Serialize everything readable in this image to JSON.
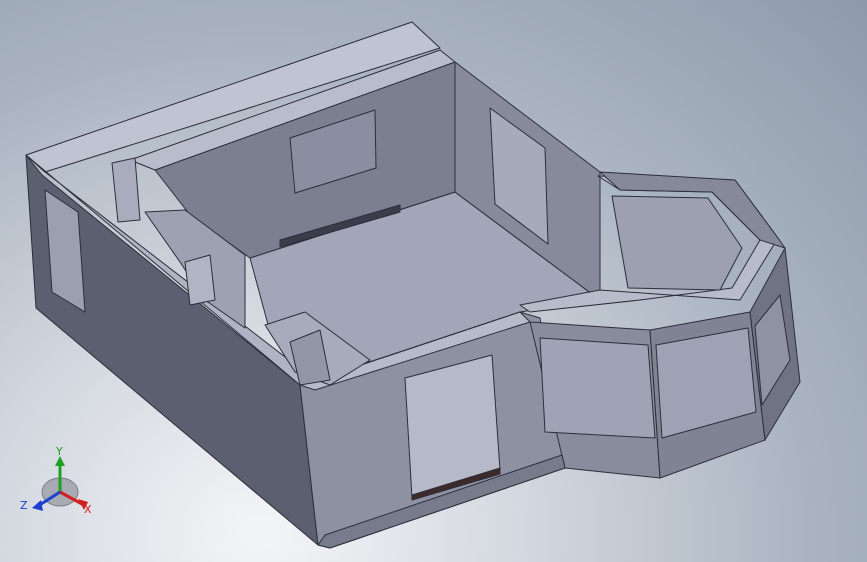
{
  "triad": {
    "x_label": "X",
    "y_label": "Y",
    "z_label": "Z",
    "colors": {
      "x": "#d02020",
      "y": "#20a020",
      "z": "#2040d0"
    }
  },
  "icons": [
    "axis-triad-icon"
  ]
}
